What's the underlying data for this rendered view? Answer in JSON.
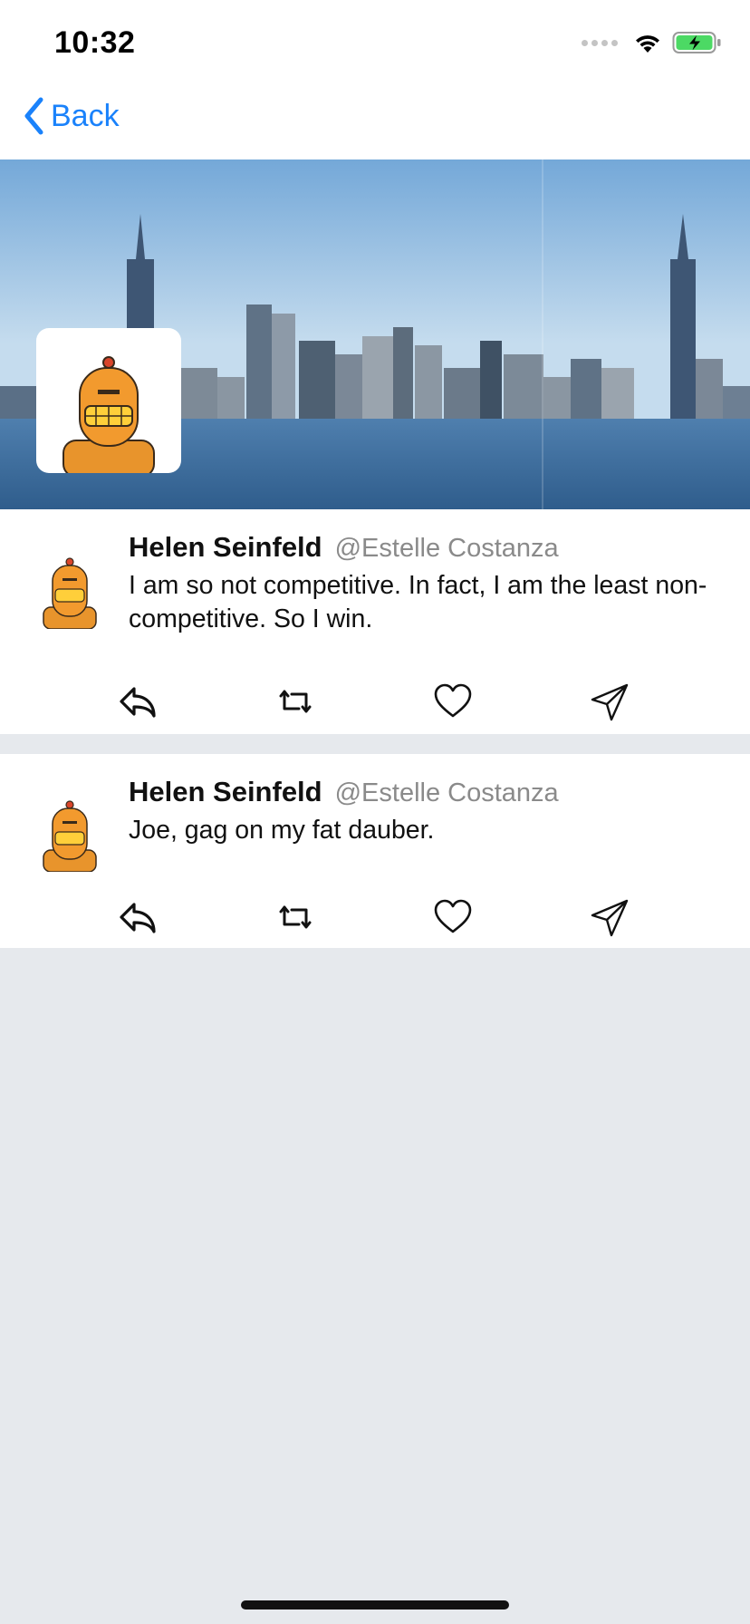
{
  "status_bar": {
    "time": "10:32",
    "icons": [
      "signal-icon",
      "wifi-icon",
      "battery-charging-icon"
    ]
  },
  "nav": {
    "back_label": "Back",
    "back_icon": "chevron-left-icon",
    "accent": "#1a82fb"
  },
  "profile": {
    "banner": "city-skyline-image",
    "avatar": "robot-avatar-image"
  },
  "tweets": [
    {
      "name": "Helen Seinfeld",
      "handle": "@Estelle Costanza",
      "text": "I am so not competitive. In fact, I am the least non-competitive. So I win."
    },
    {
      "name": "Helen Seinfeld",
      "handle": "@Estelle Costanza",
      "text": "Joe, gag on my fat dauber."
    }
  ],
  "actions": [
    {
      "icon": "reply-icon"
    },
    {
      "icon": "retweet-icon"
    },
    {
      "icon": "heart-icon"
    },
    {
      "icon": "share-icon"
    }
  ]
}
